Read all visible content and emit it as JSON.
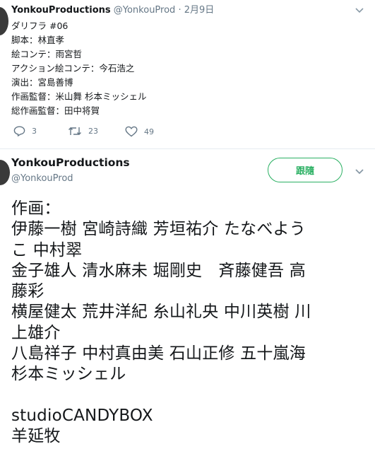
{
  "first_tweet": {
    "display_name": "YonkouProductions",
    "handle": "@YonkouProd",
    "separator": "·",
    "date": "2月9日",
    "lines": [
      "ダリフラ #06",
      "脚本：林直孝",
      "絵コンテ：雨宮哲",
      "アクション絵コンテ：今石浩之",
      "演出：宮島善博",
      "作画監督：米山舞 杉本ミッシェル",
      "総作画監督：田中将賀"
    ],
    "reply_count": "3",
    "retweet_count": "23",
    "like_count": "49"
  },
  "main_tweet": {
    "display_name": "YonkouProductions",
    "handle": "@YonkouProd",
    "follow_label": "跟隨",
    "lines": [
      "作画：",
      "伊藤一樹 宮崎詩織 芳垣祐介 たなべよう",
      "こ 中村翠",
      "金子雄人 清水麻未 堀剛史　斉藤健吾 高",
      "藤彩",
      "横屋健太 荒井洋紀 糸山礼央 中川英樹 川",
      "上雄介",
      "八島祥子 中村真由美 石山正修 五十嵐海",
      "杉本ミッシェル",
      "",
      "studioCANDYBOX",
      "羊延牧"
    ]
  },
  "colors": {
    "follow_green": "#2bb063",
    "secondary_text": "#657786",
    "primary_text": "#14171a"
  }
}
